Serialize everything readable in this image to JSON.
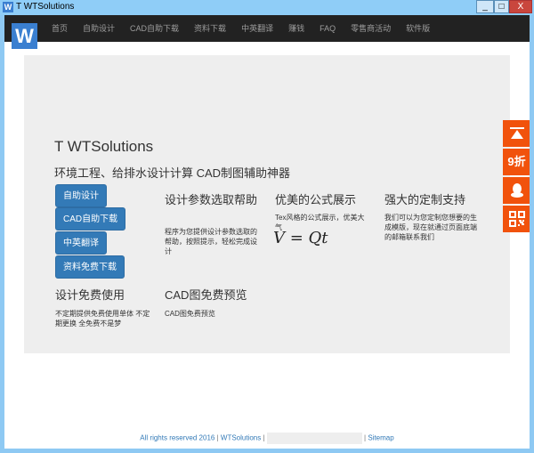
{
  "window": {
    "title": "T WTSolutions",
    "icon": "W",
    "minimize": "_",
    "maximize": "□",
    "close": "X"
  },
  "nav": {
    "logo": "W",
    "items": [
      "首页",
      "自助设计",
      "CAD自助下载",
      "资料下载",
      "中英翻译",
      "赚钱",
      "FAQ",
      "零售商活动",
      "软件版"
    ]
  },
  "hero": {
    "title": "T WTSolutions",
    "subtitle": "环境工程、给排水设计计算 CAD制图辅助神器"
  },
  "buttons": [
    "自助设计",
    "CAD自助下载",
    "中英翻译",
    "资料免费下载"
  ],
  "features": [
    {
      "title": "设计参数选取帮助",
      "text": "程序为您提供设计参数选取的帮助，按照提示，轻松完成设计"
    },
    {
      "title": "优美的公式展示",
      "text": "Tex风格的公式展示，优美大气",
      "formula": "V = Qt"
    },
    {
      "title": "强大的定制支持",
      "text": "我们可以为您定制您想要的生成模版，现在就通过页面底端的邮箱联系我们"
    },
    {
      "title": "设计免费使用",
      "text": "不定期提供免费使用单体 不定期更换 全免费不是梦"
    },
    {
      "title": "CAD图免费预览",
      "text": "CAD图免费预览"
    }
  ],
  "side": {
    "top_icon": "back-to-top",
    "discount": "9折",
    "qq_icon": "qq",
    "qr_icon": "qr-code"
  },
  "footer": {
    "rights": "All rights reserved 2016",
    "brand": "WTSolutions",
    "sitemap": "Sitemap",
    "sep": "|"
  },
  "colors": {
    "accent": "#337ab7",
    "side": "#f1520c",
    "nav": "#222222"
  }
}
